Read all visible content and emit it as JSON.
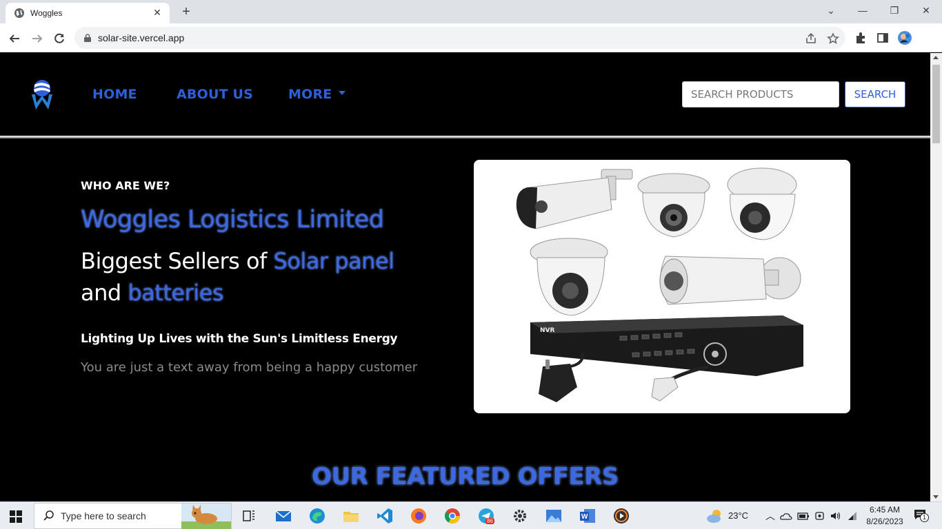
{
  "browser": {
    "tab_title": "Woggles",
    "tab_close": "✕",
    "new_tab": "+",
    "url": "solar-site.vercel.app",
    "window_controls": {
      "dropdown": "⌄",
      "minimize": "—",
      "restore": "❐",
      "close": "✕"
    }
  },
  "nav": {
    "home": "HOME",
    "about": "ABOUT US",
    "more": "MORE",
    "search_placeholder": "SEARCH PRODUCTS",
    "search_button": "SEARCH"
  },
  "hero": {
    "eyebrow": "WHO ARE WE?",
    "company": "Woggles Logistics Limited",
    "tagline_1": "Biggest Sellers of ",
    "tagline_highlight_1": "Solar panel",
    "tagline_2": "and ",
    "tagline_highlight_2": "batteries",
    "subheading": "Lighting Up Lives with the Sun's Limitless Energy",
    "description": "You are just a text away from being a happy customer",
    "image_nvr_label": "NVR"
  },
  "featured": {
    "title": "OUR FEATURED OFFERS"
  },
  "taskbar": {
    "search_placeholder": "Type here to search",
    "telegram_badge": "86",
    "weather": "23°C",
    "time": "6:45 AM",
    "date": "8/26/2023",
    "notification_count": "1"
  },
  "colors": {
    "accent": "#2f5fd8",
    "heading_blue": "#3c68e0",
    "page_bg": "#000000"
  },
  "icons": [
    "globe-icon",
    "lock-icon",
    "share-icon",
    "star-icon",
    "extensions-icon",
    "sidepanel-icon",
    "profile-icon",
    "windows-start-icon",
    "search-icon",
    "task-view-icon",
    "mail-icon",
    "edge-icon",
    "file-explorer-icon",
    "vscode-icon",
    "firefox-icon",
    "chrome-icon",
    "telegram-icon",
    "settings-icon",
    "photos-icon",
    "word-icon",
    "media-player-icon",
    "weather-icon",
    "onedrive-icon",
    "battery-icon",
    "meet-icon",
    "volume-icon",
    "wifi-icon",
    "notification-icon"
  ]
}
